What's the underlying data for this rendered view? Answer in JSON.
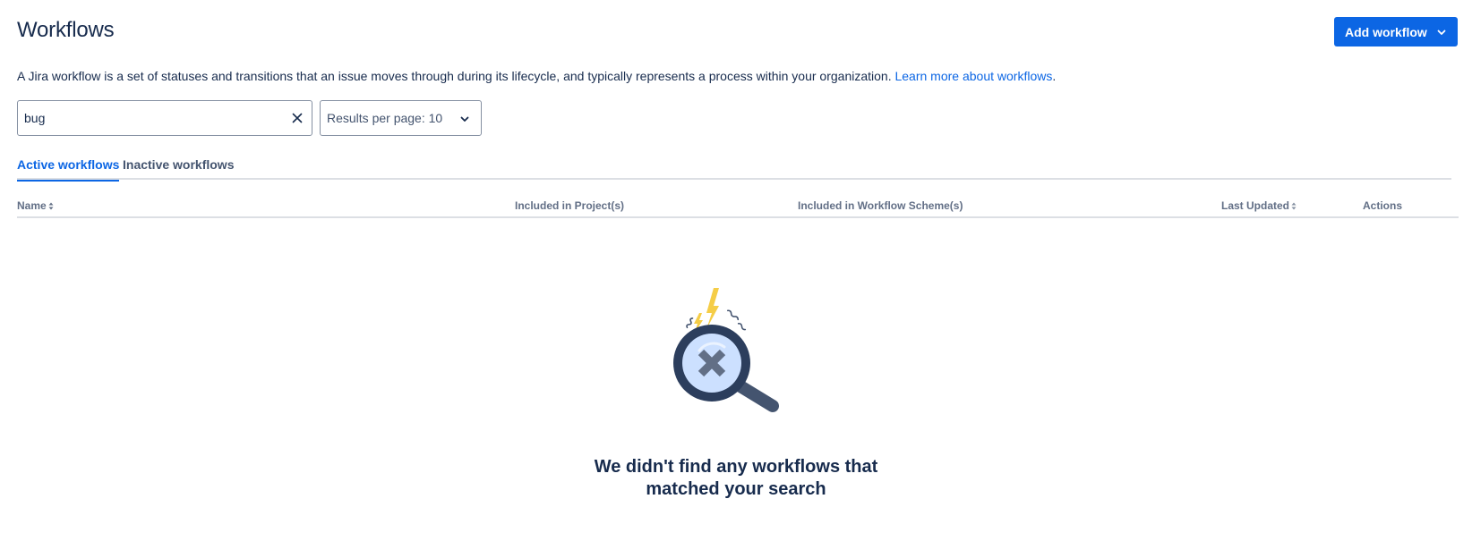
{
  "header": {
    "title": "Workflows",
    "add_button_label": "Add workflow",
    "add_button_icon": "chevron-down-icon"
  },
  "description": {
    "text": "A Jira workflow is a set of statuses and transitions that an issue moves through during its lifecycle, and typically represents a process within your organization. ",
    "link_label": "Learn more about workflows",
    "trailing": "."
  },
  "filters": {
    "search_value": "bug",
    "clear_icon": "close-icon",
    "per_page_label": "Results per page: 10",
    "per_page_icon": "chevron-down-icon"
  },
  "tabs": [
    {
      "label": "Active workflows",
      "active": true
    },
    {
      "label": "Inactive workflows",
      "active": false
    }
  ],
  "table": {
    "columns": [
      {
        "label": "Name",
        "sortable": true
      },
      {
        "label": "Included in Project(s)",
        "sortable": false
      },
      {
        "label": "Included in Workflow Scheme(s)",
        "sortable": false
      },
      {
        "label": "Last Updated",
        "sortable": true
      },
      {
        "label": "Actions",
        "sortable": false
      }
    ]
  },
  "empty_state": {
    "illustration": "magnifier-no-results-icon",
    "message": "We didn't find any workflows that matched your search"
  },
  "colors": {
    "primary": "#0c66e4",
    "text": "#172b4d",
    "subtle_text": "#44546f",
    "border": "#dcdfe4",
    "accent_yellow": "#f5cd47"
  }
}
